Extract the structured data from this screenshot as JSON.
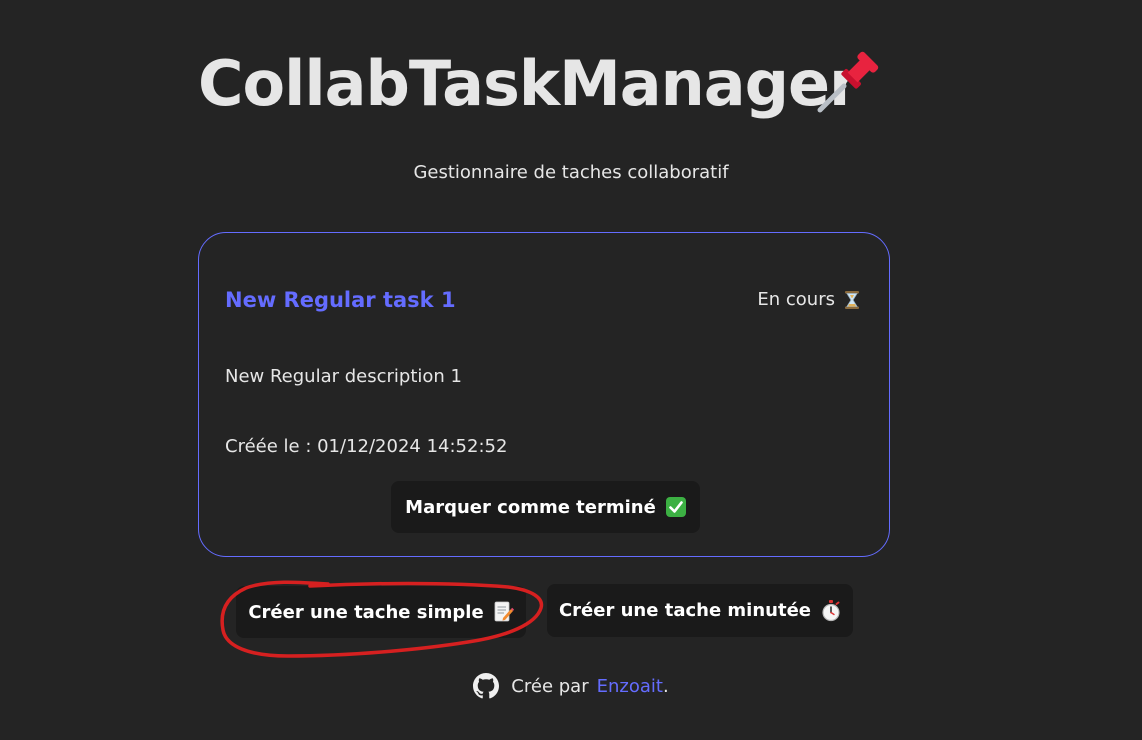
{
  "app": {
    "title": "CollabTaskManager",
    "title_icon": "pushpin-icon",
    "subtitle": "Gestionnaire de taches collaboratif"
  },
  "task": {
    "title": "New Regular task 1",
    "status_label": "En cours",
    "status_icon": "hourglass-icon",
    "description": "New Regular description 1",
    "created": "Créée le : 01/12/2024 14:52:52",
    "complete_label": "Marquer comme terminé",
    "complete_icon": "check-box-icon"
  },
  "actions": {
    "simple_label": "Créer une tache simple",
    "simple_icon": "memo-icon",
    "timed_label": "Créer une tache minutée",
    "timed_icon": "stopwatch-icon"
  },
  "footer": {
    "prefix": "Crée par",
    "author": "Enzoait",
    "suffix": ".",
    "icon": "github-icon"
  },
  "colors": {
    "background": "#242424",
    "accent": "#646cff",
    "button": "#1a1a1a",
    "annotation": "#d62020"
  }
}
